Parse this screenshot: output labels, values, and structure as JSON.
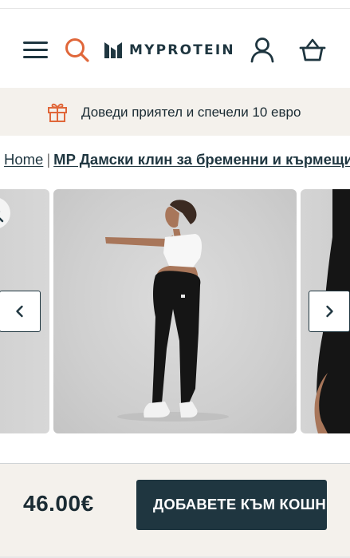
{
  "brand": {
    "name": "MYPROTEIN",
    "accent_color": "#e0673a",
    "primary_color": "#1f3640",
    "promo_bg": "#f4f1ec"
  },
  "header": {
    "icons": [
      "menu-icon",
      "search-icon",
      "myprotein-logo-icon",
      "account-icon",
      "basket-icon"
    ]
  },
  "promo": {
    "text": "Доведи приятел и спечели 10 евро",
    "icon": "gift-icon"
  },
  "breadcrumb": {
    "home": "Home",
    "separator": "|",
    "current": "MP Дамски клин за бременни и кърмещи"
  },
  "gallery": {
    "icons": [
      "zoom-in-icon",
      "chevron-left-icon",
      "chevron-right-icon"
    ]
  },
  "purchase": {
    "price": "46.00€",
    "add_to_basket_label": "ДОБАВЕТЕ КЪМ КОШНИЦАТА"
  }
}
